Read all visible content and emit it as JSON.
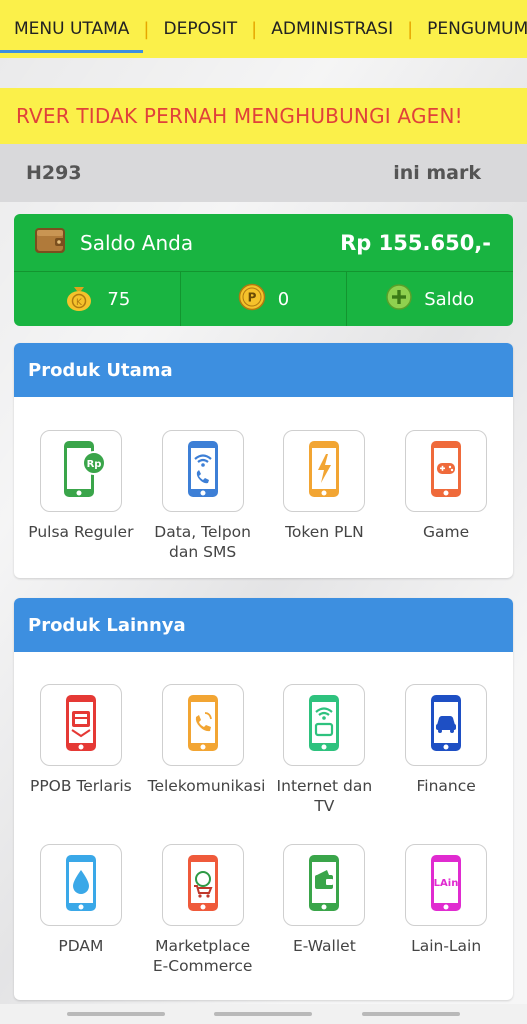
{
  "tabs": [
    {
      "label": "MENU UTAMA"
    },
    {
      "label": "DEPOSIT"
    },
    {
      "label": "ADMINISTRASI"
    },
    {
      "label": "PENGUMUMAN"
    }
  ],
  "marquee": "RVER TIDAK PERNAH MENGHUBUNGI AGEN!",
  "user": {
    "id": "H293",
    "name": "ini mark"
  },
  "saldo": {
    "label": "Saldo Anda",
    "amount": "Rp 155.650,-",
    "koin": "75",
    "poin": "0",
    "add_label": "Saldo"
  },
  "produk_utama": {
    "title": "Produk Utama",
    "items": [
      {
        "label": "Pulsa Reguler",
        "icon": "pulsa-icon",
        "color": "#3aa54a"
      },
      {
        "label": "Data, Telpon dan SMS",
        "icon": "data-icon",
        "color": "#3d7fd6"
      },
      {
        "label": "Token PLN",
        "icon": "token-icon",
        "color": "#f2a533"
      },
      {
        "label": "Game",
        "icon": "game-icon",
        "color": "#ef6a3b"
      }
    ]
  },
  "produk_lainnya": {
    "title": "Produk Lainnya",
    "items": [
      {
        "label": "PPOB Terlaris",
        "icon": "ppob-icon",
        "color": "#e53935"
      },
      {
        "label": "Telekomunikasi",
        "icon": "telekom-icon",
        "color": "#f2a533"
      },
      {
        "label": "Internet dan TV",
        "icon": "internet-icon",
        "color": "#2ec27e"
      },
      {
        "label": "Finance",
        "icon": "finance-icon",
        "color": "#1e4fc4"
      },
      {
        "label": "PDAM",
        "icon": "pdam-icon",
        "color": "#3aa8e8"
      },
      {
        "label": "Marketplace E-Commerce",
        "icon": "marketplace-icon",
        "color": "#ef5a3b"
      },
      {
        "label": "E-Wallet",
        "icon": "ewallet-icon",
        "color": "#3aa54a"
      },
      {
        "label": "Lain-Lain",
        "icon": "lain-icon",
        "color": "#e02bd0"
      }
    ]
  }
}
